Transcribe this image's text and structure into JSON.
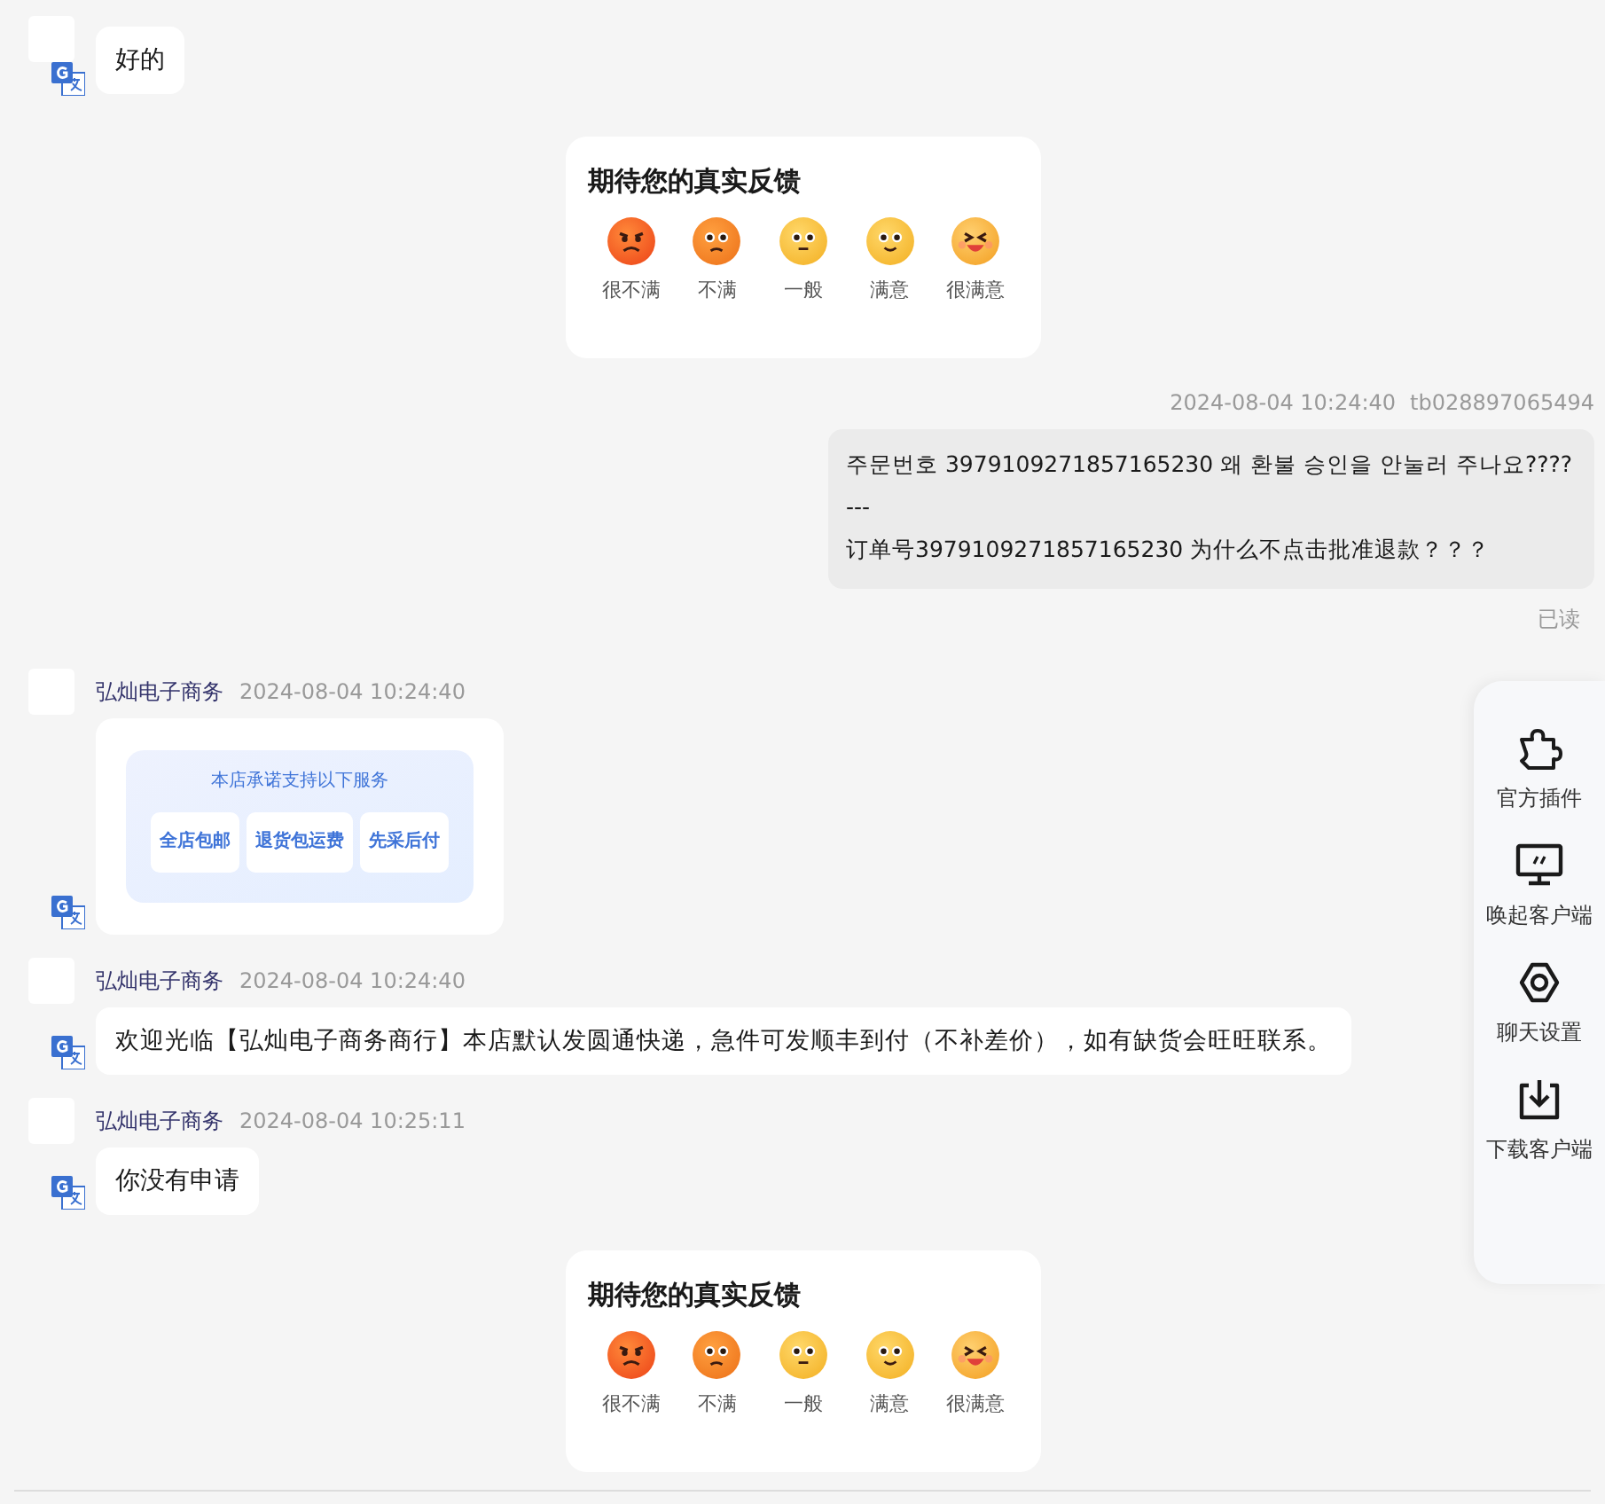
{
  "messages": [
    {
      "kind": "text",
      "text": "好的"
    },
    {
      "kind": "feedback",
      "title": "期待您的真实反馈",
      "options": [
        {
          "label": "很不满"
        },
        {
          "label": "不满"
        },
        {
          "label": "一般"
        },
        {
          "label": "满意"
        },
        {
          "label": "很满意"
        }
      ]
    },
    {
      "kind": "outgoing_text",
      "time": "2024-08-04 10:24:40",
      "sender": "tb028897065494",
      "text": "주문번호 3979109271857165230 왜 환불 승인을 안눌러 주나요????\n---\n订单号3979109271857165230 为什么不点击批准退款？？？",
      "status": "已读"
    },
    {
      "kind": "service_card",
      "sender": "弘灿电子商务",
      "time": "2024-08-04 10:24:40",
      "title": "本店承诺支持以下服务",
      "services": [
        "全店包邮",
        "退货包运费",
        "先采后付"
      ]
    },
    {
      "kind": "text",
      "sender": "弘灿电子商务",
      "time": "2024-08-04 10:24:40",
      "text": "欢迎光临【弘灿电子商务商行】本店默认发圆通快递，急件可发顺丰到付（不补差价），如有缺货会旺旺联系。"
    },
    {
      "kind": "text",
      "sender": "弘灿电子商务",
      "time": "2024-08-04 10:25:11",
      "text": "你没有申请"
    },
    {
      "kind": "feedback",
      "title": "期待您的真实反馈",
      "options": [
        {
          "label": "很不满"
        },
        {
          "label": "不满"
        },
        {
          "label": "一般"
        },
        {
          "label": "满意"
        },
        {
          "label": "很满意"
        }
      ]
    }
  ],
  "side_panel": [
    {
      "label": "官方插件"
    },
    {
      "label": "唤起客户端"
    },
    {
      "label": "聊天设置"
    },
    {
      "label": "下载客户端"
    }
  ]
}
